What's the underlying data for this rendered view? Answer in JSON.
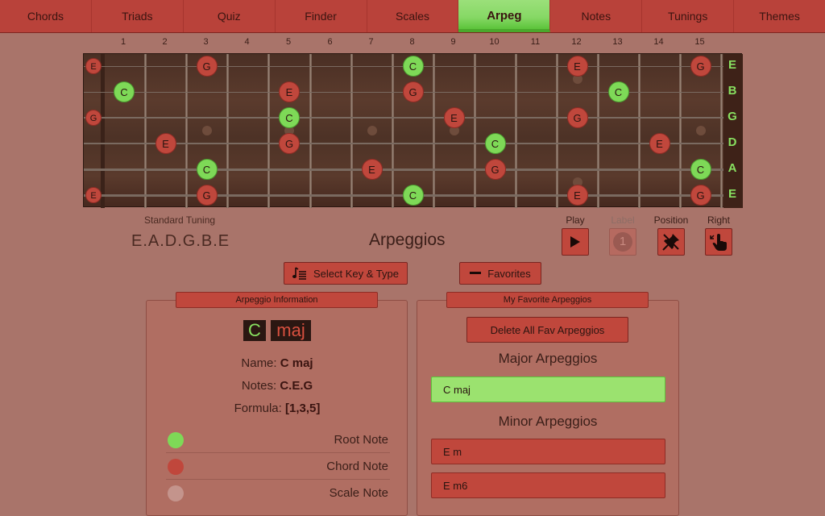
{
  "nav": {
    "tabs": [
      "Chords",
      "Triads",
      "Quiz",
      "Finder",
      "Scales",
      "Arpeg",
      "Notes",
      "Tunings",
      "Themes"
    ],
    "active": "Arpeg"
  },
  "fretboard": {
    "fret_numbers": [
      "1",
      "2",
      "3",
      "4",
      "5",
      "6",
      "7",
      "8",
      "9",
      "10",
      "11",
      "12",
      "13",
      "14",
      "15"
    ],
    "string_labels": [
      "E",
      "B",
      "G",
      "D",
      "A",
      "E"
    ],
    "notes": [
      {
        "string": 0,
        "fret": 0,
        "name": "E",
        "type": "chord"
      },
      {
        "string": 0,
        "fret": 3,
        "name": "G",
        "type": "chord"
      },
      {
        "string": 0,
        "fret": 8,
        "name": "C",
        "type": "root"
      },
      {
        "string": 0,
        "fret": 12,
        "name": "E",
        "type": "chord"
      },
      {
        "string": 0,
        "fret": 15,
        "name": "G",
        "type": "chord"
      },
      {
        "string": 1,
        "fret": 1,
        "name": "C",
        "type": "root"
      },
      {
        "string": 1,
        "fret": 5,
        "name": "E",
        "type": "chord"
      },
      {
        "string": 1,
        "fret": 8,
        "name": "G",
        "type": "chord"
      },
      {
        "string": 1,
        "fret": 13,
        "name": "C",
        "type": "root"
      },
      {
        "string": 2,
        "fret": 0,
        "name": "G",
        "type": "chord"
      },
      {
        "string": 2,
        "fret": 5,
        "name": "C",
        "type": "root"
      },
      {
        "string": 2,
        "fret": 9,
        "name": "E",
        "type": "chord"
      },
      {
        "string": 2,
        "fret": 12,
        "name": "G",
        "type": "chord"
      },
      {
        "string": 3,
        "fret": 2,
        "name": "E",
        "type": "chord"
      },
      {
        "string": 3,
        "fret": 5,
        "name": "G",
        "type": "chord"
      },
      {
        "string": 3,
        "fret": 10,
        "name": "C",
        "type": "root"
      },
      {
        "string": 3,
        "fret": 14,
        "name": "E",
        "type": "chord"
      },
      {
        "string": 4,
        "fret": 3,
        "name": "C",
        "type": "root"
      },
      {
        "string": 4,
        "fret": 7,
        "name": "E",
        "type": "chord"
      },
      {
        "string": 4,
        "fret": 10,
        "name": "G",
        "type": "chord"
      },
      {
        "string": 4,
        "fret": 15,
        "name": "C",
        "type": "root"
      },
      {
        "string": 5,
        "fret": 0,
        "name": "E",
        "type": "chord"
      },
      {
        "string": 5,
        "fret": 3,
        "name": "G",
        "type": "chord"
      },
      {
        "string": 5,
        "fret": 8,
        "name": "C",
        "type": "root"
      },
      {
        "string": 5,
        "fret": 12,
        "name": "E",
        "type": "chord"
      },
      {
        "string": 5,
        "fret": 15,
        "name": "G",
        "type": "chord"
      }
    ]
  },
  "tuning": {
    "label": "Standard Tuning",
    "value": "E.A.D.G.B.E"
  },
  "section_title": "Arpeggios",
  "controls": {
    "play": "Play",
    "label": "Label",
    "label_value": "1",
    "position": "Position",
    "right": "Right"
  },
  "actions": {
    "select": "Select Key & Type",
    "favorites": "Favorites"
  },
  "info_panel": {
    "title": "Arpeggio Information",
    "key": "C",
    "type": "maj",
    "name_label": "Name:",
    "name_value": "C maj",
    "notes_label": "Notes:",
    "notes_value": "C.E.G",
    "formula_label": "Formula:",
    "formula_value": "[1,3,5]",
    "legend": [
      {
        "label": "Root Note",
        "color": "#7ed957"
      },
      {
        "label": "Chord Note",
        "color": "#c0473c"
      },
      {
        "label": "Scale Note",
        "color": "#c4948c"
      }
    ]
  },
  "fav_panel": {
    "title": "My Favorite Arpeggios",
    "delete_button": "Delete All Fav Arpeggios",
    "major_heading": "Major Arpeggios",
    "major_items": [
      "C maj"
    ],
    "minor_heading": "Minor Arpeggios",
    "minor_items": [
      "E m",
      "E m6"
    ]
  }
}
